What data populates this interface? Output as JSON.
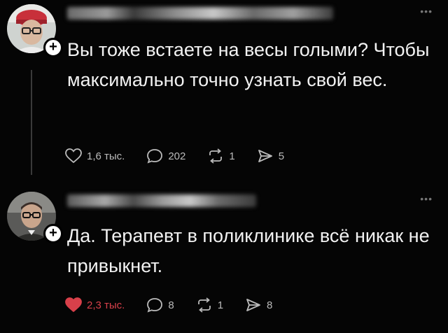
{
  "posts": [
    {
      "text": "Вы тоже встаете на весы голыми? Чтобы максимально точно узнать свой вес.",
      "liked": false,
      "actions": {
        "likes": "1,6 тыс.",
        "replies": "202",
        "reposts": "1",
        "shares": "5"
      }
    },
    {
      "text": "Да. Терапевт в поликлинике всё никак не привыкнет.",
      "liked": true,
      "actions": {
        "likes": "2,3 тыс.",
        "replies": "8",
        "reposts": "1",
        "shares": "8"
      }
    }
  ],
  "icons": {
    "like": "heart-icon",
    "reply": "speech-bubble-icon",
    "repost": "repost-icon",
    "share": "send-icon",
    "follow": "plus-icon",
    "more": "more-dots-icon"
  },
  "colors": {
    "background": "#000000",
    "text": "#f2f2f2",
    "secondary_text": "#bbbbbb",
    "liked": "#d8404a"
  }
}
